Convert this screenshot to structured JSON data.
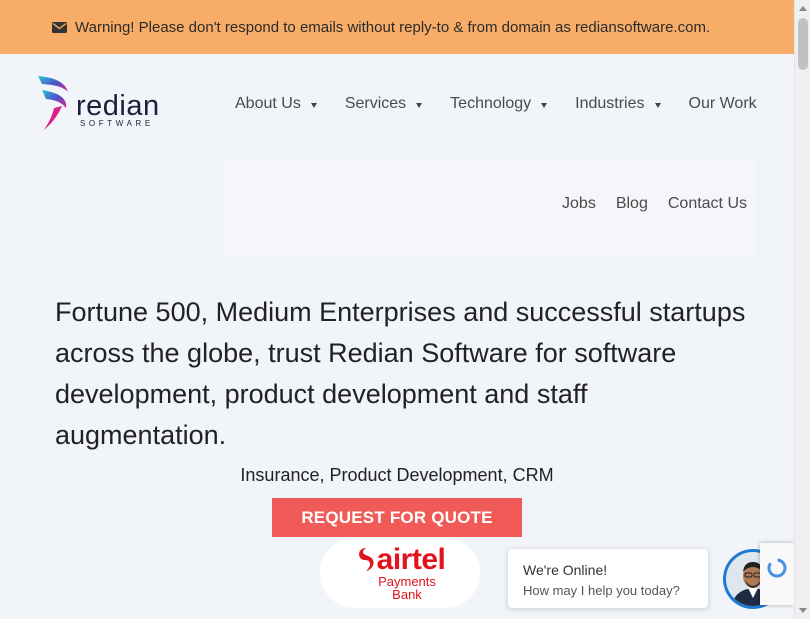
{
  "warning": {
    "icon": "envelope-icon",
    "text": "Warning! Please don't respond to emails without reply-to & from domain as rediansoftware.com."
  },
  "logo": {
    "brand": "redian",
    "tagline": "SOFTWARE"
  },
  "nav": {
    "primary": [
      {
        "label": "About Us",
        "dropdown": true
      },
      {
        "label": "Services",
        "dropdown": true
      },
      {
        "label": "Technology",
        "dropdown": true
      },
      {
        "label": "Industries",
        "dropdown": true
      },
      {
        "label": "Our Work",
        "dropdown": false
      }
    ],
    "secondary": [
      {
        "label": "Jobs"
      },
      {
        "label": "Blog"
      },
      {
        "label": "Contact Us"
      }
    ]
  },
  "hero": {
    "headline": "Fortune 500, Medium Enterprises and successful startups across the globe, trust Redian Software for software development, product development and staff augmentation.",
    "subline": "Insurance, Product Development, CRM",
    "cta_label": "REQUEST FOR QUOTE"
  },
  "client_logo": {
    "name": "airtel",
    "line1": "Payments",
    "line2": "Bank"
  },
  "chat": {
    "status": "We're Online!",
    "prompt": "How may I help you today?"
  },
  "colors": {
    "warning_bg": "#f7ad67",
    "cta_bg": "#f05a57",
    "page_bg": "#f1f4f8",
    "airtel_red": "#e1141e",
    "avatar_ring": "#1e7ad3"
  }
}
